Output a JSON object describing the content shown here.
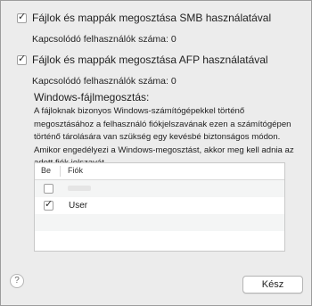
{
  "smb": {
    "checked": true,
    "label": "Fájlok és mappák megosztása SMB használatával",
    "connected_users": "Kapcsolódó felhasználók száma: 0"
  },
  "afp": {
    "checked": true,
    "label": "Fájlok és mappák megosztása AFP használatával",
    "connected_users": "Kapcsolódó felhasználók száma: 0"
  },
  "windows": {
    "title": "Windows-fájlmegosztás:",
    "description": "A fájloknak bizonyos Windows-számítógépekkel történő megosztásához a felhasználó fiókjelszavának ezen a számítógépen történő tárolására van szükség egy kevésbé biztonságos módon. Amikor engedélyezi a Windows-megosztást, akkor meg kell adnia az adott fiók jelszavát.",
    "table": {
      "columns": [
        "Be",
        "Fiók"
      ],
      "rows": [
        {
          "checked": false,
          "account": ""
        },
        {
          "checked": true,
          "account": "User"
        }
      ]
    }
  },
  "icons": {
    "help": "question-mark-icon",
    "check": "checkmark-icon"
  },
  "footer": {
    "help_label": "?",
    "done_label": "Kész"
  }
}
